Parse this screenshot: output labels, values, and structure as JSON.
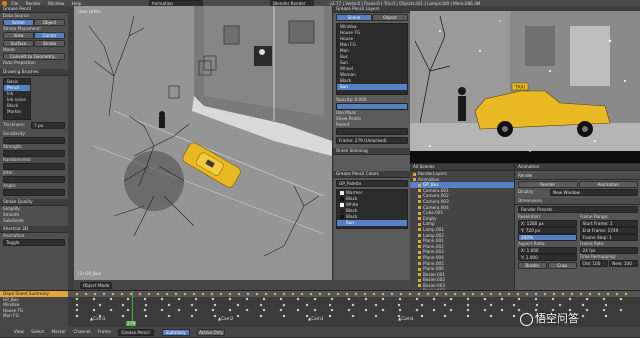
{
  "topbar": {
    "menus": [
      "File",
      "Render",
      "Window",
      "Help"
    ],
    "editor_type": "Animation",
    "engine": "Blender Render",
    "stats": "v2.77 | Verts:0 | Faces:0 | Tris:0 | Objects:0/1 | Lamps:0/0 | Mem:286.3M"
  },
  "left_panel": {
    "tabs": [
      "Tools",
      "Grease Pencil"
    ],
    "data_source_label": "Data Source:",
    "data_source_options": [
      "Scene",
      "Object"
    ],
    "stroke_placement_label": "Stroke Placement:",
    "placement_options": [
      "View",
      "Cursor",
      "Surface",
      "Stroke"
    ],
    "mode_label": "Mode:",
    "convert_button": "Convert to Geometry...",
    "auto_proportion": "Auto Proportion",
    "drawing_brushes_label": "Drawing Brushes",
    "brushes": [
      "Basic",
      "Pencil",
      "Ink",
      "Ink noise",
      "Block",
      "Marker",
      "Charcoal"
    ],
    "selected_brush": "Pencil",
    "thickness_label": "Thickness:",
    "thickness_value": "7 px",
    "sensitivity_label": "Sensitivity:",
    "strength_label": "Strength:",
    "randomness_label": "Randomness:",
    "jitter_label": "Jitter:",
    "angle_label": "Angle:",
    "stroke_quality_label": "Stroke Quality",
    "simplify_label": "Simplify",
    "smooth_label": "Smooth",
    "subdivide_label": "Subdivide",
    "section_label": "Shortcut 3D",
    "animation_label": "Animation",
    "animation_value": "Toggle"
  },
  "viewport": {
    "label": "User Ortho",
    "object_label": "(1) GP_Bus"
  },
  "gp_layers_panel": {
    "tabs": [
      "Scene",
      "Object"
    ],
    "header": "Grease Pencil Layers",
    "layers": [
      "Window",
      "House FG",
      "House",
      "Man FG",
      "Man",
      "Bus",
      "Sun",
      "Wheel",
      "Woman",
      "Black",
      "Sun"
    ],
    "selected_index": 10,
    "opacity_label": "Opacity:",
    "opacity_value": "0.000",
    "blend_label": "Use Mask",
    "show_x_ray_label": "Show Points",
    "parent_label": "Parent",
    "frame_label": "Frame: 279 (Unlocked)",
    "onion_label": "Onion Skinning",
    "colors_header": "Grease Pencil Colors",
    "colors": [
      "Warmer",
      "Black",
      "White",
      "Black",
      "Black",
      "Sun"
    ],
    "palette_label": "GP_Palette"
  },
  "render_view": {
    "taxi_sign": "TAXI"
  },
  "outliner": {
    "header": "All Scenes",
    "items": [
      "RenderLayers",
      "Animation",
      "GP_Bus",
      "Camera.001",
      "Camera.002",
      "Camera.003",
      "Camera.004",
      "Cube.001",
      "Empty",
      "Lamp",
      "Lamp.001",
      "Lamp.002",
      "Plane.001",
      "Plane.002",
      "Plane.003",
      "Plane.004",
      "Plane.005",
      "Plane.006",
      "Bezier.001",
      "Bezier.002",
      "Bezier.003",
      "Bezier.004",
      "BezierCircle",
      "Bezier.005",
      "Bezier.006",
      "Bezier.007",
      "Bezier.008"
    ],
    "selected_index": 2
  },
  "properties": {
    "tabs": [
      "Render",
      "Animation"
    ],
    "scene_label": "Animation",
    "render_label": "Render",
    "dimensions_label": "Dimensions",
    "presets_label": "Render Presets",
    "resolution_label": "Resolution:",
    "res_x": "X: 1280 px",
    "res_y": "Y: 720 px",
    "res_pct": "100%",
    "aspect_label": "Aspect Ratio:",
    "aspect_x": "X: 1.000",
    "aspect_y": "Y: 1.000",
    "frame_range_label": "Frame Range:",
    "start_frame": "Start Frame: 1",
    "end_frame": "End Frame: 1749",
    "frame_step": "Frame Step: 1",
    "frame_rate_label": "Frame Rate:",
    "frame_rate_value": "24 fps",
    "time_remapping": "Time Remapping:",
    "old": "Old: 100",
    "new": "New: 100",
    "border_label": "Border",
    "crop_label": "Crop",
    "display_label": "Display",
    "image_editor": "New Window"
  },
  "timeline": {
    "channels": [
      "Dope Sheet Summary",
      "GP_Bus",
      "Window",
      "House FG",
      "Man FG"
    ],
    "mode": "Grease Pencil",
    "summary_label": "Summary",
    "active_only": "Active Only",
    "markers": [
      "Cam1",
      "Cam2",
      "Cam3",
      "Cam4",
      "Cam5"
    ],
    "current_frame_label": "279"
  },
  "bottom_menus": [
    "View",
    "Select",
    "Marker",
    "Channel",
    "Frame"
  ],
  "object_mode_label": "Object Mode",
  "watermark": "悟空问答",
  "colors": {
    "accent": "#5680c2",
    "taxi": "#e8b923",
    "timeline_sel": "#e2a53b"
  }
}
